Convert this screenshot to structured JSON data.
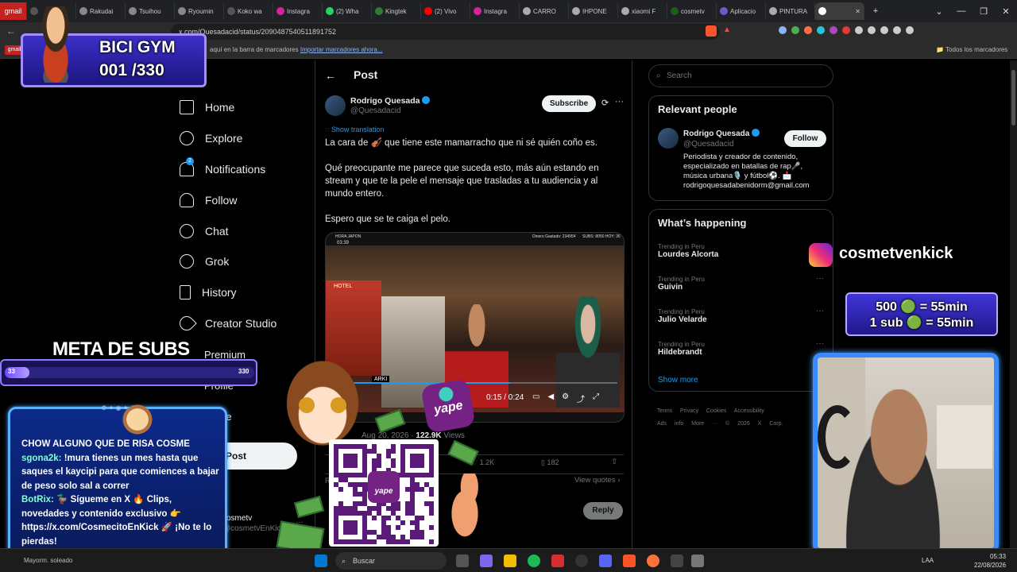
{
  "browser": {
    "tabs": [
      "gmail",
      "",
      "Rakudai",
      "Tsuihou",
      "Ryoumin",
      "Koko wa",
      "Instagra",
      "(2) Wha",
      "Kingtek",
      "(2) Vivo",
      "Instagra",
      "CARRO",
      "IHPONE",
      "xiaomi F",
      "cosmetv",
      "Aplicacio",
      "PINTURA",
      ""
    ],
    "url": "x.com/Quesadacid/status/2090487540511891752",
    "bookmarks_hint": "aquí en la barra de marcadores",
    "bookmarks_import": "Importar marcadores ahora...",
    "bookmarks_all": "Todos los marcadores",
    "chip_label": "gmail"
  },
  "sidebar": {
    "items": [
      {
        "label": "Home",
        "icon": "home-icon"
      },
      {
        "label": "Explore",
        "icon": "search-icon"
      },
      {
        "label": "Notifications",
        "icon": "bell-icon",
        "badge": "2"
      },
      {
        "label": "Follow",
        "icon": "person-add-icon"
      },
      {
        "label": "Chat",
        "icon": "chat-icon"
      },
      {
        "label": "Grok",
        "icon": "grok-icon"
      },
      {
        "label": "History",
        "icon": "bookmark-icon"
      },
      {
        "label": "Creator Studio",
        "icon": "rocket-icon"
      }
    ],
    "partial_items": [
      "Premium",
      "Profile",
      "More"
    ],
    "post_button": "Post",
    "account_name": "cosmetv",
    "account_handle": "@cosmetvEnKick"
  },
  "post": {
    "header": "Post",
    "author_name": "Rodrigo Quesada",
    "author_handle": "@Quesadacid",
    "subscribe": "Subscribe",
    "show_translation": "Show translation",
    "paragraphs": [
      "La cara de 🎻 que tiene este mamarracho que ni sé quién coño es.",
      "Qué preocupante me parece que suceda esto, más aún estando en stream y que te la pele el mensaje que trasladas a tu audiencia y al mundo entero.",
      "Espero que se te caiga el pelo."
    ],
    "video_time": "0:15 / 0:24",
    "video_live_label": "HORA JAPON",
    "video_clock": "03:39",
    "video_stats": "Dinero Gastado: 23495¥",
    "video_subs": "SUBS: 8050 HOY: 36",
    "video_hotel": "HOTEL",
    "video_tag": "ARKI",
    "meta_date": "Aug 20, 2026",
    "meta_views": "122.9K",
    "meta_views_label": "Views",
    "likes": "1.2K",
    "bookmarks": "182",
    "view_quotes": "View quotes",
    "reply_btn": "Reply",
    "reply_label": "R"
  },
  "right": {
    "search_placeholder": "Search",
    "relevant_title": "Relevant people",
    "person_name": "Rodrigo Quesada",
    "person_handle": "@Quesadacid",
    "follow": "Follow",
    "bio": "Periodista y creador de contenido, especializado en batallas de rap🎤, música urbana🎙️ y fútbol⚽. 📩 rodrigoquesadabenidorm@gmail.com",
    "happening_title": "What’s happening",
    "trends": [
      {
        "context": "Trending in Peru",
        "name": "Lourdes Alcorta"
      },
      {
        "context": "Trending in Peru",
        "name": "Guivin"
      },
      {
        "context": "Trending in Peru",
        "name": "Julio Velarde"
      },
      {
        "context": "Trending in Peru",
        "name": "Hildebrandt"
      }
    ],
    "show_more": "Show more",
    "footer": [
      "Terms",
      "Privacy",
      "Cookies",
      "Accessibility",
      "Ads info",
      "More ···",
      "© 2026 X Corp."
    ]
  },
  "overlay": {
    "gym_title": "BICI GYM",
    "gym_count": "001 /330",
    "meta_title": "META DE SUBS",
    "meta_current": "33",
    "meta_goal": "330",
    "meta_progress": 0.1,
    "instagram_handle": "cosmetvenkick",
    "rate_line1": "500 🟢 = 55min",
    "rate_line2": "1 sub 🟢 = 55min",
    "yape_label": "yape",
    "chat": [
      {
        "user": "",
        "text": "CHOW ALGUNO QUE DE RISA COSME"
      },
      {
        "user": "sgona2k:",
        "text": "!mura tienes un mes hasta que saques el kaycipi para que comiences a bajar de peso solo sal a correr"
      },
      {
        "user": "BotRix:",
        "text": "🦆 Sígueme en X 🔥 Clips, novedades y contenido exclusivo 👉 https://x.com/CosmecitoEnKick 🚀 ¡No te lo pierdas!"
      }
    ]
  },
  "taskbar": {
    "search": "Buscar",
    "lang": "LAA",
    "time": "05:33",
    "date": "22/08/2026",
    "weather": "Mayorm. soleado"
  }
}
